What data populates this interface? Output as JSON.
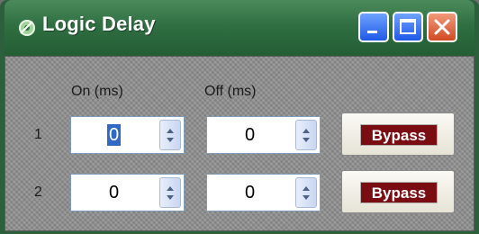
{
  "window": {
    "title": "Logic Delay",
    "icon": "green-gear-icon",
    "controls": [
      "minimize",
      "maximize",
      "close"
    ]
  },
  "headers": {
    "on": "On (ms)",
    "off": "Off (ms)"
  },
  "rows": [
    {
      "label": "1",
      "on_value": "0",
      "off_value": "0",
      "bypass_label": "Bypass",
      "on_selected": true
    },
    {
      "label": "2",
      "on_value": "0",
      "off_value": "0",
      "bypass_label": "Bypass",
      "on_selected": false
    }
  ],
  "colors": {
    "titlebar": "#2f6f41",
    "bypass_indicator": "#7a0d12",
    "selection": "#316ac5"
  }
}
